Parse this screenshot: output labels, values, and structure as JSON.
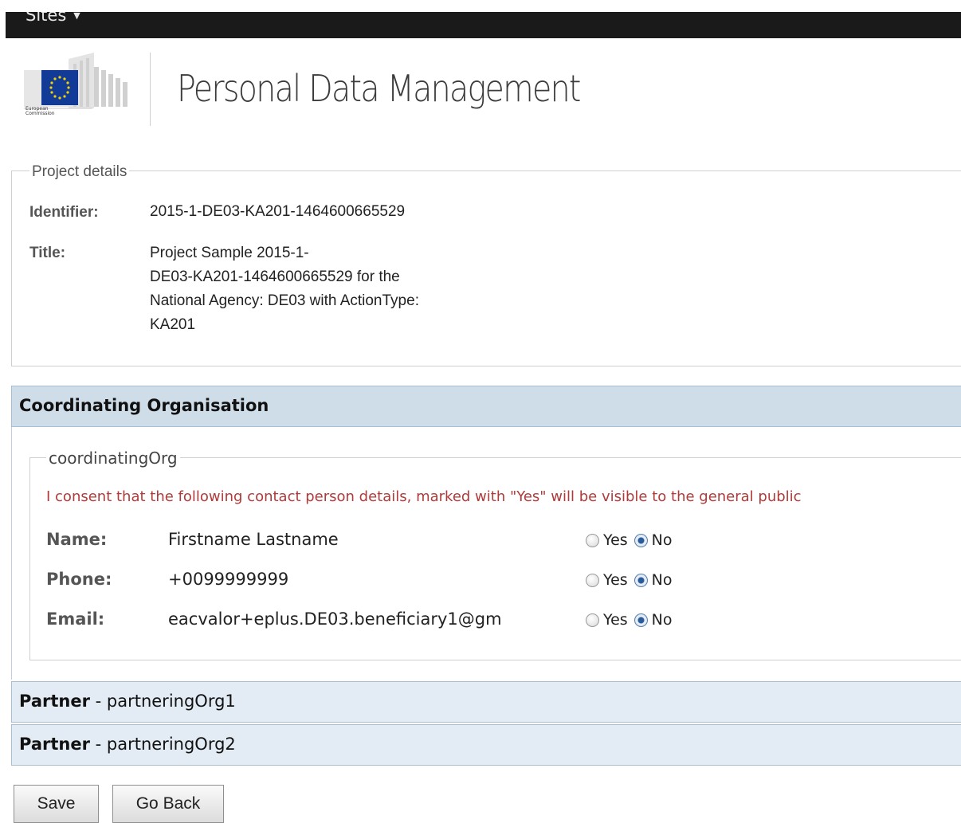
{
  "topbar": {
    "sites_label": "Sites",
    "caret": "▼"
  },
  "header": {
    "logo_caption": "European Commission",
    "title": "Personal Data Management"
  },
  "project": {
    "legend": "Project details",
    "identifier_label": "Identifier:",
    "identifier_value": "2015-1-DE03-KA201-1464600665529",
    "title_label": "Title:",
    "title_lines": [
      "Project Sample 2015-1-",
      "DE03-KA201-1464600665529 for the",
      "National Agency: DE03 with ActionType:",
      "KA201"
    ]
  },
  "coordinating": {
    "header": "Coordinating Organisation",
    "legend": "coordinatingOrg",
    "consent": "I consent that the following contact person details, marked with \"Yes\" will be visible to the general public",
    "rows": [
      {
        "label": "Name:",
        "value": "Firstname Lastname",
        "yes": "Yes",
        "no": "No",
        "selected": "No"
      },
      {
        "label": "Phone:",
        "value": "+0099999999",
        "yes": "Yes",
        "no": "No",
        "selected": "No"
      },
      {
        "label": "Email:",
        "value": "eacvalor+eplus.DE03.beneficiary1@gm",
        "yes": "Yes",
        "no": "No",
        "selected": "No"
      }
    ]
  },
  "partners": [
    {
      "prefix": "Partner",
      "separator": " - ",
      "name": "partneringOrg1"
    },
    {
      "prefix": "Partner",
      "separator": " - ",
      "name": "partneringOrg2"
    }
  ],
  "buttons": {
    "save": "Save",
    "back": "Go Back"
  },
  "colors": {
    "topbar": "#1a1a1a",
    "section_header": "#cfdde9",
    "partner_bar": "#e3ecf5",
    "consent_text": "#b13a3a"
  }
}
